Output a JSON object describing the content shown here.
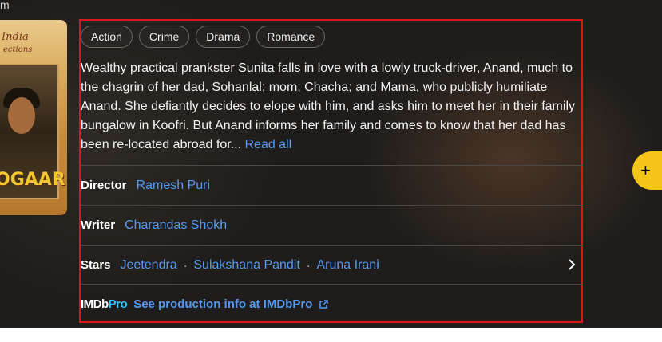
{
  "top_fragment": "m",
  "poster": {
    "logo_line1": "India",
    "logo_line2": "ections",
    "title_fragment": "OGAAR"
  },
  "genres": [
    "Action",
    "Crime",
    "Drama",
    "Romance"
  ],
  "plot": {
    "text": "Wealthy practical prankster Sunita falls in love with a lowly truck-driver, Anand, much to the chagrin of her dad, Sohanlal; mom; Chacha; and Mama, who publicly humiliate Anand. She defiantly decides to elope with him, and asks him to meet her in their family bungalow in Koofri. But Anand informs her family and comes to know that her dad has been re-located abroad for...",
    "read_all": "Read all"
  },
  "credits": {
    "director_label": "Director",
    "director": "Ramesh Puri",
    "writer_label": "Writer",
    "writer": "Charandas Shokh",
    "stars_label": "Stars",
    "stars": [
      "Jeetendra",
      "Sulakshana Pandit",
      "Aruna Irani"
    ],
    "separator": "·"
  },
  "imdbpro": {
    "logo_imdb": "IMDb",
    "logo_pro": "Pro",
    "link": "See production info at IMDbPro"
  },
  "watchlist_button": {
    "icon": "plus-icon",
    "label_fragment": "+"
  },
  "colors": {
    "link": "#5799ef",
    "highlight_border": "#e0141e",
    "watchlist": "#f5c518",
    "pro_cyan": "#2dc8ff"
  }
}
